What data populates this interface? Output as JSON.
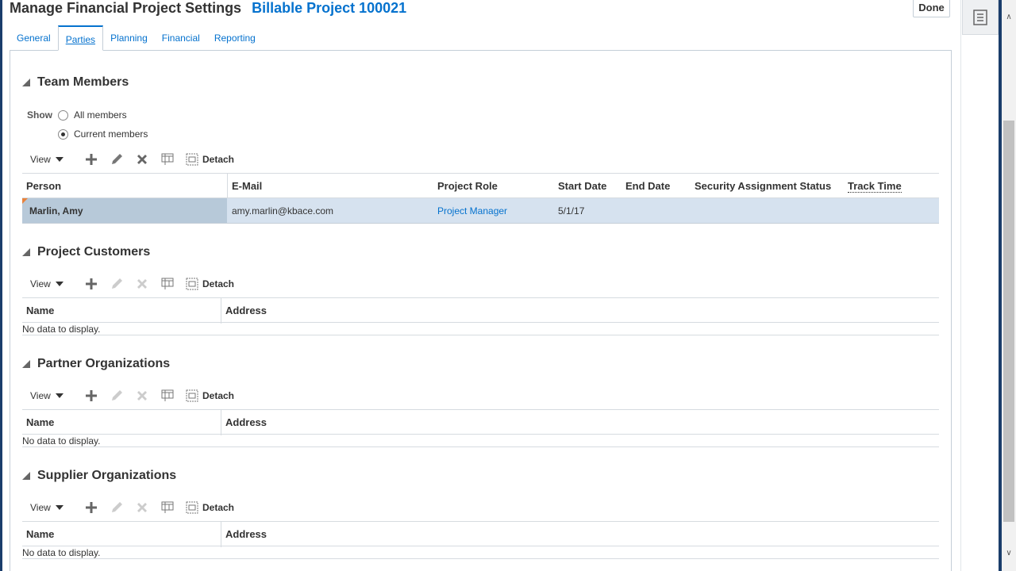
{
  "header": {
    "title": "Manage Financial Project Settings",
    "project": "Billable Project 100021",
    "done_label": "Done"
  },
  "tabs": [
    {
      "label": "General"
    },
    {
      "label": "Parties",
      "active": true
    },
    {
      "label": "Planning"
    },
    {
      "label": "Financial"
    },
    {
      "label": "Reporting"
    }
  ],
  "team": {
    "title": "Team Members",
    "show_label": "Show",
    "options": [
      {
        "label": "All members",
        "selected": false
      },
      {
        "label": "Current members",
        "selected": true
      }
    ],
    "toolbar": {
      "view": "View",
      "detach": "Detach"
    },
    "columns": [
      "Person",
      "E-Mail",
      "Project Role",
      "Start Date",
      "End Date",
      "Security Assignment Status",
      "Track Time"
    ],
    "rows": [
      {
        "person": "Marlin, Amy",
        "email": "amy.marlin@kbace.com",
        "role": "Project Manager",
        "start": "5/1/17",
        "end": "",
        "security": "",
        "track": ""
      }
    ]
  },
  "customers": {
    "title": "Project Customers",
    "toolbar": {
      "view": "View",
      "detach": "Detach"
    },
    "columns": [
      "Name",
      "Address"
    ],
    "empty": "No data to display."
  },
  "partners": {
    "title": "Partner Organizations",
    "toolbar": {
      "view": "View",
      "detach": "Detach"
    },
    "columns": [
      "Name",
      "Address"
    ],
    "empty": "No data to display."
  },
  "suppliers": {
    "title": "Supplier Organizations",
    "toolbar": {
      "view": "View",
      "detach": "Detach"
    },
    "columns": [
      "Name",
      "Address"
    ],
    "empty": "No data to display."
  },
  "colors": {
    "accent": "#0572ce",
    "selected_row": "#d6e2ef",
    "frame": "#1a3d6b"
  },
  "icons": [
    "add-icon",
    "edit-icon",
    "delete-icon",
    "freeze-icon",
    "detach-icon",
    "collapse-icon",
    "page-icon"
  ]
}
